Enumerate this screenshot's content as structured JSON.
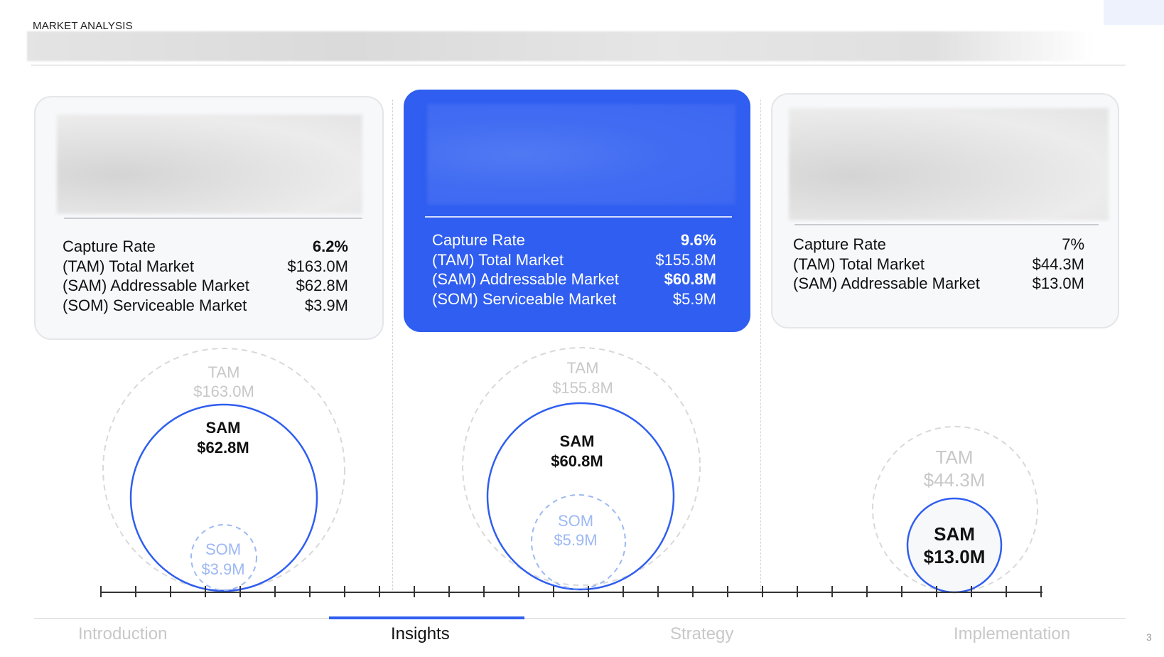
{
  "header": {
    "section_label": "MARKET ANALYSIS"
  },
  "cards": [
    {
      "rows": [
        {
          "label": "Capture Rate",
          "value": "6.2%",
          "bold": true
        },
        {
          "label": "(TAM) Total Market",
          "value": "$163.0M",
          "bold": false
        },
        {
          "label": "(SAM) Addressable Market",
          "value": "$62.8M",
          "bold": false
        },
        {
          "label": "(SOM) Serviceable Market",
          "value": "$3.9M",
          "bold": false
        }
      ]
    },
    {
      "active": true,
      "rows": [
        {
          "label": "Capture Rate",
          "value": "9.6%",
          "bold": true
        },
        {
          "label": "(TAM) Total Market",
          "value": "$155.8M",
          "bold": false
        },
        {
          "label": "(SAM) Addressable Market",
          "value": "$60.8M",
          "bold": true
        },
        {
          "label": "(SOM) Serviceable Market",
          "value": "$5.9M",
          "bold": false
        }
      ]
    },
    {
      "rows": [
        {
          "label": "Capture Rate",
          "value": "7%",
          "bold": false
        },
        {
          "label": "(TAM) Total Market",
          "value": "$44.3M",
          "bold": false
        },
        {
          "label": "(SAM) Addressable Market",
          "value": "$13.0M",
          "bold": false
        }
      ]
    }
  ],
  "markets": [
    {
      "tam_label": "TAM",
      "tam_value": "$163.0M",
      "sam_label": "SAM",
      "sam_value": "$62.8M",
      "som_label": "SOM",
      "som_value": "$3.9M"
    },
    {
      "tam_label": "TAM",
      "tam_value": "$155.8M",
      "sam_label": "SAM",
      "sam_value": "$60.8M",
      "som_label": "SOM",
      "som_value": "$5.9M"
    },
    {
      "tam_label": "TAM",
      "tam_value": "$44.3M",
      "sam_label": "SAM",
      "sam_value": "$13.0M"
    }
  ],
  "nav": {
    "items": [
      "Introduction",
      "Insights",
      "Strategy",
      "Implementation"
    ],
    "active_index": 1
  },
  "page_number": "3",
  "colors": {
    "accent": "#2f5ef0",
    "sam_stroke": "#2f5ef0",
    "som_stroke": "#9db8f3",
    "tam_stroke": "#d9d9d9",
    "muted_text": "#c8c8c8"
  }
}
